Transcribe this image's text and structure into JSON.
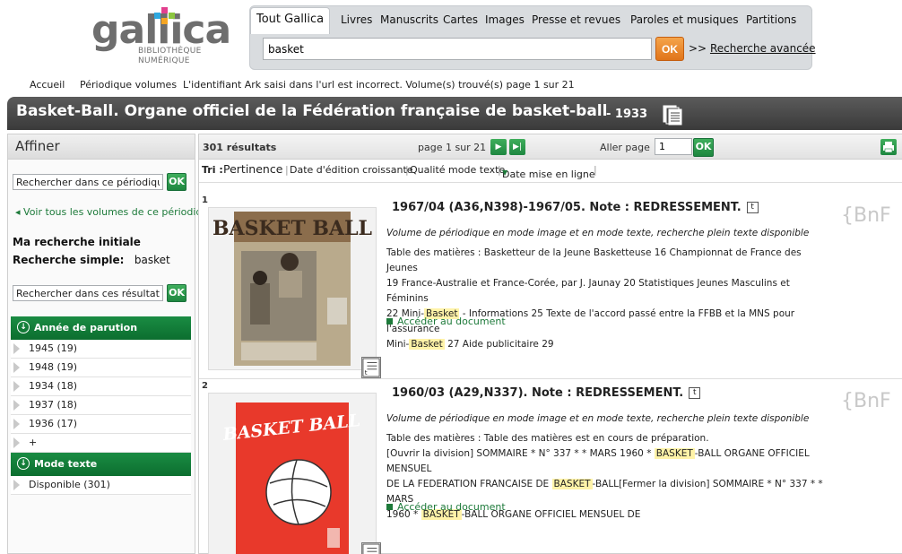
{
  "logo": {
    "word": "gallica",
    "sub1": "BIBLIOTHÈQUE",
    "sub2": "NUMÉRIQUE"
  },
  "tabs": [
    "Tout Gallica",
    "Livres",
    "Manuscrits",
    "Cartes",
    "Images",
    "Presse et revues",
    "Paroles et musiques",
    "Partitions"
  ],
  "search": {
    "value": "basket",
    "ok_label": "OK",
    "advanced_prefix": ">> ",
    "advanced_label": "Recherche avancée"
  },
  "breadcrumb": {
    "home": "Accueil",
    "volumes": "Périodique volumes",
    "message": "L'identifiant Ark saisi dans l'url est incorrect. Volume(s) trouvé(s) page 1 sur 21"
  },
  "title": {
    "main": "Basket-Ball. Organe officiel de la Fédération française de basket-ball",
    "year": "- 1933"
  },
  "sidebar": {
    "header": "Affiner",
    "search_periodical_placeholder": "Rechercher dans ce périodique",
    "ok_label": "OK",
    "back_link": "Voir tous les volumes de ce périodique",
    "initial_search_label": "Ma recherche initiale",
    "simple_search_label": "Recherche simple:",
    "simple_search_value": "basket",
    "search_results_placeholder": "Rechercher dans ces résultats",
    "facets": [
      {
        "title": "Année de parution",
        "items": [
          "1945 (19)",
          "1948 (19)",
          "1934 (18)",
          "1937 (18)",
          "1936 (17)",
          "+"
        ]
      },
      {
        "title": "Mode texte",
        "items": [
          "Disponible (301)"
        ]
      }
    ]
  },
  "toolbar": {
    "count": "301 résultats",
    "page": "page 1 sur 21",
    "goto_label": "Aller page",
    "goto_value": "1",
    "ok_label": "OK"
  },
  "sort": {
    "label": "Tri :",
    "options": [
      "Pertinence",
      "Date d'édition croissante",
      "Qualité mode texte",
      "Date mise en ligne"
    ]
  },
  "results": [
    {
      "number": "1",
      "title": "1967/04 (A36,N398)-1967/05. Note : REDRESSEMENT.",
      "badge": "t",
      "description": "Volume de périodique en mode image et en mode texte, recherche plein texte disponible",
      "body_1": "Table des matières : Basketteur de la Jeune Basketteuse 16 Championnat de France des Jeunes",
      "body_2": "19 France-Australie et France-Corée, par J. Jaunay 20 Statistiques Jeunes Masculins et Féminins",
      "body_3a": "22 Mini-",
      "hl_1": "Basket",
      "body_3b": " - Informations 25 Texte de l'accord passé entre la FFBB et la MNS pour l'assurance",
      "body_4a": "Mini-",
      "hl_2": "Basket",
      "body_4b": " 27 Aide publicitaire 29",
      "access": "Accéder au document",
      "watermark": "{BnF",
      "cover": "BASKET BALL"
    },
    {
      "number": "2",
      "title": "1960/03 (A29,N337). Note : REDRESSEMENT.",
      "badge": "t",
      "description": "Volume de périodique en mode image et en mode texte, recherche plein texte disponible",
      "body_1": "Table des matières : Table des matières est en cours de préparation.",
      "body_2a": "[Ouvrir la division] SOMMAIRE * N° 337 * * MARS 1960 * ",
      "hl_1": "BASKET",
      "body_2b": "-BALL ORGANE OFFICIEL MENSUEL",
      "body_3a": "DE LA FEDERATION FRANCAISE DE ",
      "hl_2": "BASKET",
      "body_3b": "-BALL[Fermer la division] SOMMAIRE * N° 337 * * MARS",
      "body_4a": "1960 * ",
      "hl_3": "BASKET",
      "body_4b": "-BALL ORGANE OFFICIEL MENSUEL DE",
      "access": "Accéder au document",
      "watermark": "{BnF",
      "cover": "BASKET BALL"
    }
  ]
}
